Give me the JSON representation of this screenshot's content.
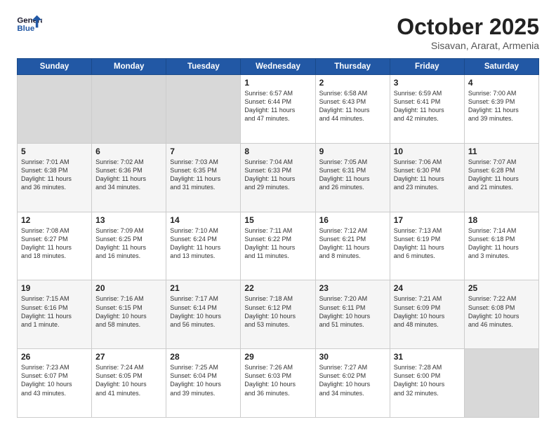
{
  "header": {
    "logo_line1": "General",
    "logo_line2": "Blue",
    "month": "October 2025",
    "location": "Sisavan, Ararat, Armenia"
  },
  "weekdays": [
    "Sunday",
    "Monday",
    "Tuesday",
    "Wednesday",
    "Thursday",
    "Friday",
    "Saturday"
  ],
  "rows": [
    [
      {
        "num": "",
        "info": ""
      },
      {
        "num": "",
        "info": ""
      },
      {
        "num": "",
        "info": ""
      },
      {
        "num": "1",
        "info": "Sunrise: 6:57 AM\nSunset: 6:44 PM\nDaylight: 11 hours\nand 47 minutes."
      },
      {
        "num": "2",
        "info": "Sunrise: 6:58 AM\nSunset: 6:43 PM\nDaylight: 11 hours\nand 44 minutes."
      },
      {
        "num": "3",
        "info": "Sunrise: 6:59 AM\nSunset: 6:41 PM\nDaylight: 11 hours\nand 42 minutes."
      },
      {
        "num": "4",
        "info": "Sunrise: 7:00 AM\nSunset: 6:39 PM\nDaylight: 11 hours\nand 39 minutes."
      }
    ],
    [
      {
        "num": "5",
        "info": "Sunrise: 7:01 AM\nSunset: 6:38 PM\nDaylight: 11 hours\nand 36 minutes."
      },
      {
        "num": "6",
        "info": "Sunrise: 7:02 AM\nSunset: 6:36 PM\nDaylight: 11 hours\nand 34 minutes."
      },
      {
        "num": "7",
        "info": "Sunrise: 7:03 AM\nSunset: 6:35 PM\nDaylight: 11 hours\nand 31 minutes."
      },
      {
        "num": "8",
        "info": "Sunrise: 7:04 AM\nSunset: 6:33 PM\nDaylight: 11 hours\nand 29 minutes."
      },
      {
        "num": "9",
        "info": "Sunrise: 7:05 AM\nSunset: 6:31 PM\nDaylight: 11 hours\nand 26 minutes."
      },
      {
        "num": "10",
        "info": "Sunrise: 7:06 AM\nSunset: 6:30 PM\nDaylight: 11 hours\nand 23 minutes."
      },
      {
        "num": "11",
        "info": "Sunrise: 7:07 AM\nSunset: 6:28 PM\nDaylight: 11 hours\nand 21 minutes."
      }
    ],
    [
      {
        "num": "12",
        "info": "Sunrise: 7:08 AM\nSunset: 6:27 PM\nDaylight: 11 hours\nand 18 minutes."
      },
      {
        "num": "13",
        "info": "Sunrise: 7:09 AM\nSunset: 6:25 PM\nDaylight: 11 hours\nand 16 minutes."
      },
      {
        "num": "14",
        "info": "Sunrise: 7:10 AM\nSunset: 6:24 PM\nDaylight: 11 hours\nand 13 minutes."
      },
      {
        "num": "15",
        "info": "Sunrise: 7:11 AM\nSunset: 6:22 PM\nDaylight: 11 hours\nand 11 minutes."
      },
      {
        "num": "16",
        "info": "Sunrise: 7:12 AM\nSunset: 6:21 PM\nDaylight: 11 hours\nand 8 minutes."
      },
      {
        "num": "17",
        "info": "Sunrise: 7:13 AM\nSunset: 6:19 PM\nDaylight: 11 hours\nand 6 minutes."
      },
      {
        "num": "18",
        "info": "Sunrise: 7:14 AM\nSunset: 6:18 PM\nDaylight: 11 hours\nand 3 minutes."
      }
    ],
    [
      {
        "num": "19",
        "info": "Sunrise: 7:15 AM\nSunset: 6:16 PM\nDaylight: 11 hours\nand 1 minute."
      },
      {
        "num": "20",
        "info": "Sunrise: 7:16 AM\nSunset: 6:15 PM\nDaylight: 10 hours\nand 58 minutes."
      },
      {
        "num": "21",
        "info": "Sunrise: 7:17 AM\nSunset: 6:14 PM\nDaylight: 10 hours\nand 56 minutes."
      },
      {
        "num": "22",
        "info": "Sunrise: 7:18 AM\nSunset: 6:12 PM\nDaylight: 10 hours\nand 53 minutes."
      },
      {
        "num": "23",
        "info": "Sunrise: 7:20 AM\nSunset: 6:11 PM\nDaylight: 10 hours\nand 51 minutes."
      },
      {
        "num": "24",
        "info": "Sunrise: 7:21 AM\nSunset: 6:09 PM\nDaylight: 10 hours\nand 48 minutes."
      },
      {
        "num": "25",
        "info": "Sunrise: 7:22 AM\nSunset: 6:08 PM\nDaylight: 10 hours\nand 46 minutes."
      }
    ],
    [
      {
        "num": "26",
        "info": "Sunrise: 7:23 AM\nSunset: 6:07 PM\nDaylight: 10 hours\nand 43 minutes."
      },
      {
        "num": "27",
        "info": "Sunrise: 7:24 AM\nSunset: 6:05 PM\nDaylight: 10 hours\nand 41 minutes."
      },
      {
        "num": "28",
        "info": "Sunrise: 7:25 AM\nSunset: 6:04 PM\nDaylight: 10 hours\nand 39 minutes."
      },
      {
        "num": "29",
        "info": "Sunrise: 7:26 AM\nSunset: 6:03 PM\nDaylight: 10 hours\nand 36 minutes."
      },
      {
        "num": "30",
        "info": "Sunrise: 7:27 AM\nSunset: 6:02 PM\nDaylight: 10 hours\nand 34 minutes."
      },
      {
        "num": "31",
        "info": "Sunrise: 7:28 AM\nSunset: 6:00 PM\nDaylight: 10 hours\nand 32 minutes."
      },
      {
        "num": "",
        "info": ""
      }
    ]
  ]
}
